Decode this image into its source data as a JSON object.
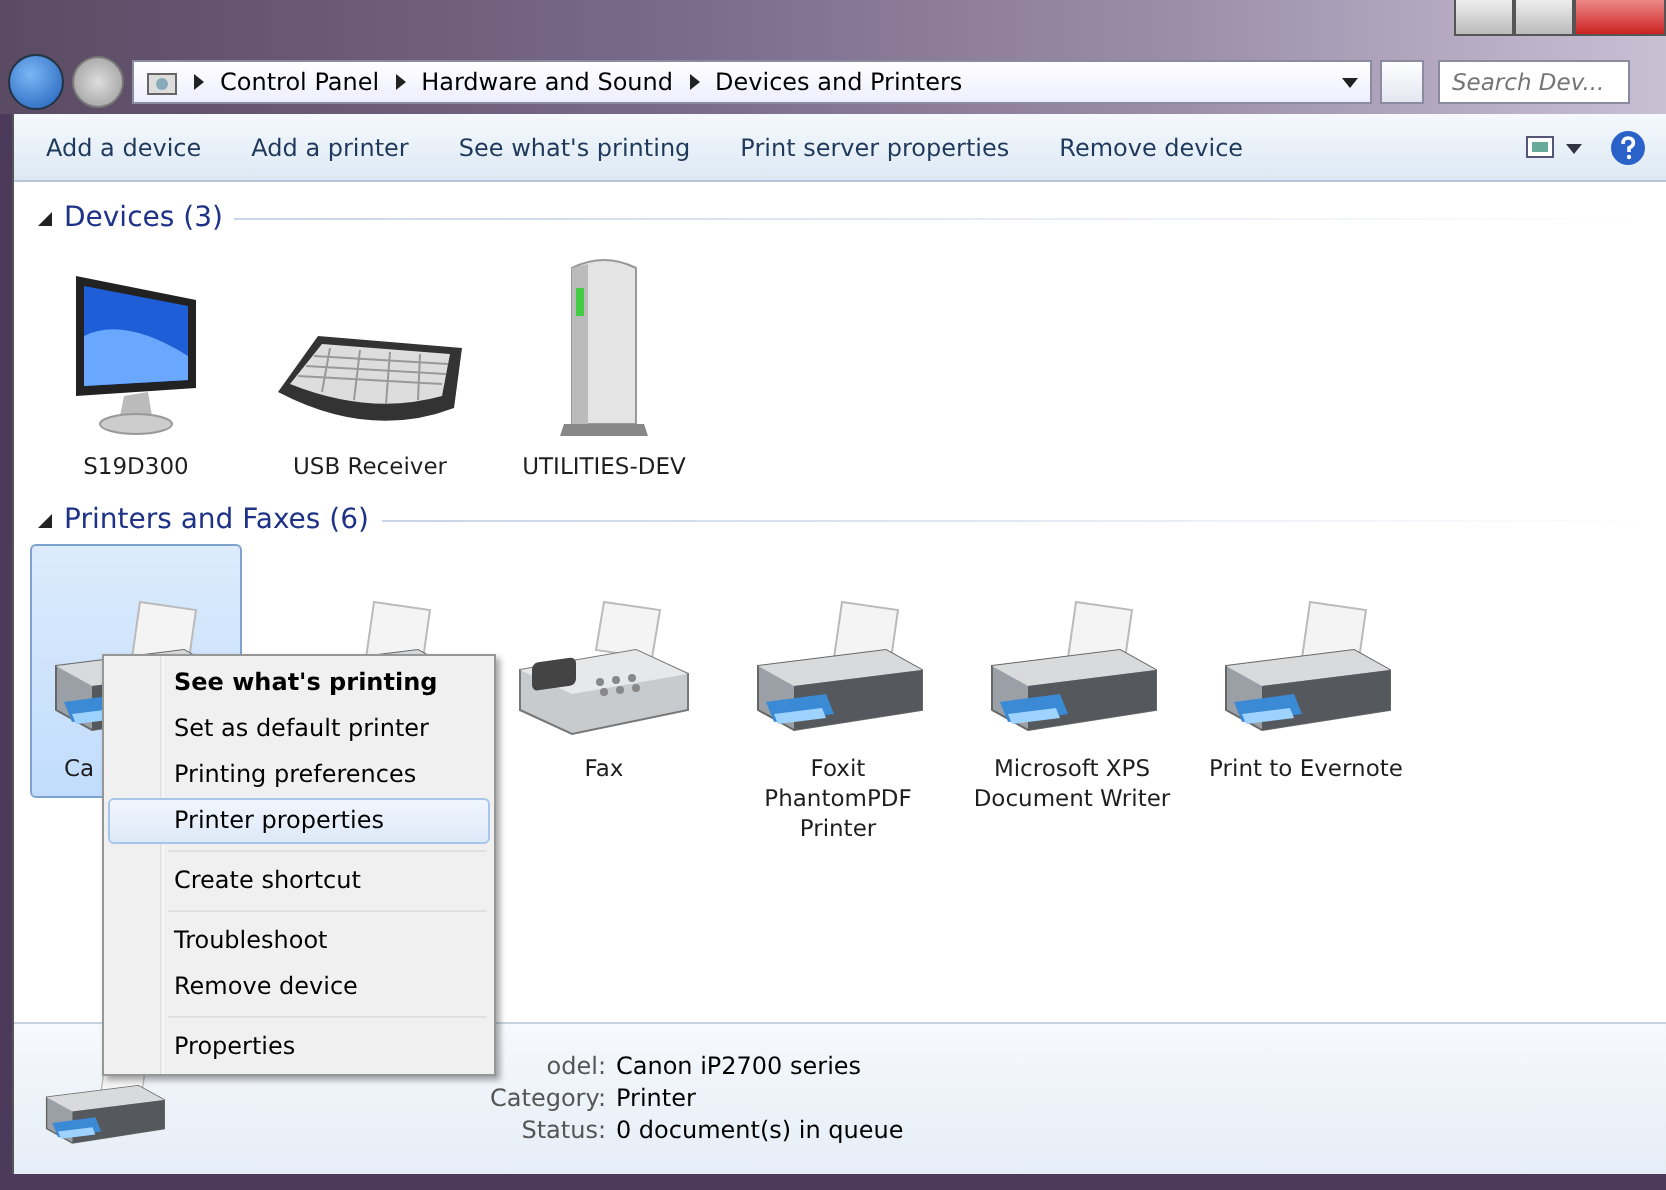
{
  "address_bar": {
    "breadcrumb": [
      "Control Panel",
      "Hardware and Sound",
      "Devices and Printers"
    ]
  },
  "search": {
    "placeholder": "Search Dev..."
  },
  "toolbar": {
    "buttons": [
      "Add a device",
      "Add a printer",
      "See what's printing",
      "Print server properties",
      "Remove device"
    ]
  },
  "groups": [
    {
      "title": "Devices (3)",
      "items": [
        {
          "kind": "monitor",
          "label": "S19D300",
          "selected": false
        },
        {
          "kind": "keyboard",
          "label": "USB Receiver",
          "selected": false
        },
        {
          "kind": "tower",
          "label": "UTILITIES-DEV",
          "selected": false
        }
      ]
    },
    {
      "title": "Printers and Faxes (6)",
      "items": [
        {
          "kind": "printer",
          "label": "Ca",
          "selected": true
        },
        {
          "kind": "printer",
          "selected": false
        },
        {
          "kind": "fax",
          "label": "Fax",
          "selected": false
        },
        {
          "kind": "printer",
          "label": "Foxit PhantomPDF Printer",
          "selected": false
        },
        {
          "kind": "printer",
          "label": "Microsoft XPS Document Writer",
          "selected": false
        },
        {
          "kind": "printer",
          "label": "Print to Evernote",
          "selected": false
        }
      ]
    }
  ],
  "context_menu": [
    {
      "kind": "item",
      "label": "See what's printing",
      "default": true,
      "selected": false
    },
    {
      "kind": "item",
      "label": "Set as default printer",
      "default": false,
      "selected": false
    },
    {
      "kind": "item",
      "label": "Printing preferences",
      "default": false,
      "selected": false
    },
    {
      "kind": "item",
      "label": "Printer properties",
      "default": false,
      "selected": true
    },
    {
      "kind": "separator"
    },
    {
      "kind": "item",
      "label": "Create shortcut",
      "default": false,
      "selected": false
    },
    {
      "kind": "separator"
    },
    {
      "kind": "item",
      "label": "Troubleshoot",
      "default": false,
      "selected": false
    },
    {
      "kind": "item",
      "label": "Remove device",
      "default": false,
      "selected": false
    },
    {
      "kind": "separator"
    },
    {
      "kind": "item",
      "label": "Properties",
      "default": false,
      "selected": false
    }
  ],
  "details": [
    {
      "label": "odel:",
      "value": "Canon iP2700 series"
    },
    {
      "label": "Category:",
      "value": "Printer"
    },
    {
      "label": "Status:",
      "value": "0 document(s) in queue"
    }
  ]
}
